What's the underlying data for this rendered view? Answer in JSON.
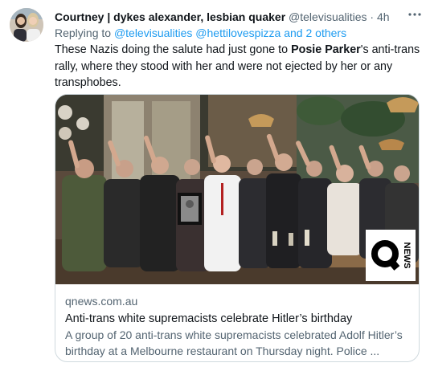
{
  "tweet": {
    "author_name": "Courtney | dykes alexander, lesbian quaker",
    "author_handle": "@televisualities",
    "separator": "·",
    "timestamp": "4h",
    "more_icon": "more-horizontal-icon",
    "reply_prefix": "Replying to",
    "reply_targets": "@televisualities @hettilovespizza and 2 others",
    "text_part1": "These Nazis doing the salute had just gone to ",
    "text_bold": "Posie Parker",
    "text_part2": "'s anti-trans rally, where they stood with her and were not ejected by her or any transphobes."
  },
  "card": {
    "logo_letter": "Q",
    "logo_word": "NEWS",
    "domain": "qnews.com.au",
    "title": "Anti-trans white supremacists celebrate Hitler’s birthday",
    "description": "A group of 20 anti-trans white supremacists celebrated Adolf Hitler’s birthday at a Melbourne restaurant on Thursday night. Police ..."
  },
  "colors": {
    "text": "#0f1419",
    "secondary": "#536471",
    "link": "#1d9bf0",
    "border": "#cfd9de"
  }
}
